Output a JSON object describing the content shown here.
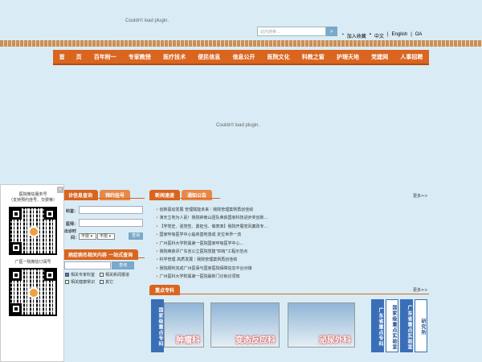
{
  "plugin_messages": {
    "top": "Couldn't load plugin.",
    "center": "Couldn't load plugin."
  },
  "search": {
    "placeholder": "站内搜索...",
    "button_icon": "search-icon"
  },
  "top_links": [
    "加入收藏",
    "中文",
    "English",
    "OA"
  ],
  "nav": [
    "首　　页",
    "百年附一",
    "专家教授",
    "医疗技术",
    "便民信息",
    "信息公开",
    "医院文化",
    "科教之窗",
    "护理天地",
    "党建网",
    "人事招聘"
  ],
  "left_panel": {
    "tabs": [
      "诊信息查询",
      "预约挂号"
    ],
    "labels": [
      "科室：",
      "医师：",
      "出诊时",
      "间："
    ],
    "select_1": "不限",
    "select_2": "不限",
    "query_button": "查询"
  },
  "symptom_search": {
    "title": "病症病名相关内容 一站式查询",
    "button": "查询",
    "options": [
      {
        "label": "相关专家科室",
        "checked": true
      },
      {
        "label": "相关新闻报道",
        "checked": false
      },
      {
        "label": "相关新闻技术",
        "checked": false
      },
      {
        "label": "相关健康常识",
        "checked": false
      },
      {
        "label": "其它",
        "checked": false
      }
    ]
  },
  "news_panel": {
    "tabs": [
      "新闻速递",
      "通知公告"
    ],
    "more": "更多>>",
    "items": [
      "创新驱动发展 管理赋能未来｜我院管理案例再创佳绩",
      "演天立地为人民！我院钟南山团队荣获国家科技进步奖创新...",
      "【学党史、强党性、勇担当、做表率】我院开展党风廉政专...",
      "国家呼吸医学中心临床基地落成 定位世界一流",
      "广州医科大学附属第一医院国家呼吸医学中心...",
      "我院荣获评广东省公立医院党建\"四有\"工程示范点",
      "科学管理 高质发展｜我院管理案例再创佳绩",
      "我院顺利完成广州医保与国家医院保障信息平台对接",
      "广州医科大学附属第一医院最新门诊就诊须知"
    ]
  },
  "specialty_panel": {
    "tab": "重点专科",
    "more": "更多>>",
    "side_label": "国家级重点专科",
    "photos": [
      "肿瘤科",
      "变态反应科",
      "泌尿外科"
    ],
    "columns": [
      "广东省重点专科",
      "国家级重点实验室",
      "广东省重点实验室",
      "研究所"
    ]
  },
  "qr_panel": {
    "close": "×",
    "caption_1_line1": "医院微信服务号",
    "caption_1_line2": "（支持预约挂号、交费等）",
    "caption_2": "广医一院微信订阅号"
  },
  "colors": {
    "nav": "#d9651f",
    "background": "#d9ecf5",
    "accent_blue": "#3a6fb8"
  }
}
